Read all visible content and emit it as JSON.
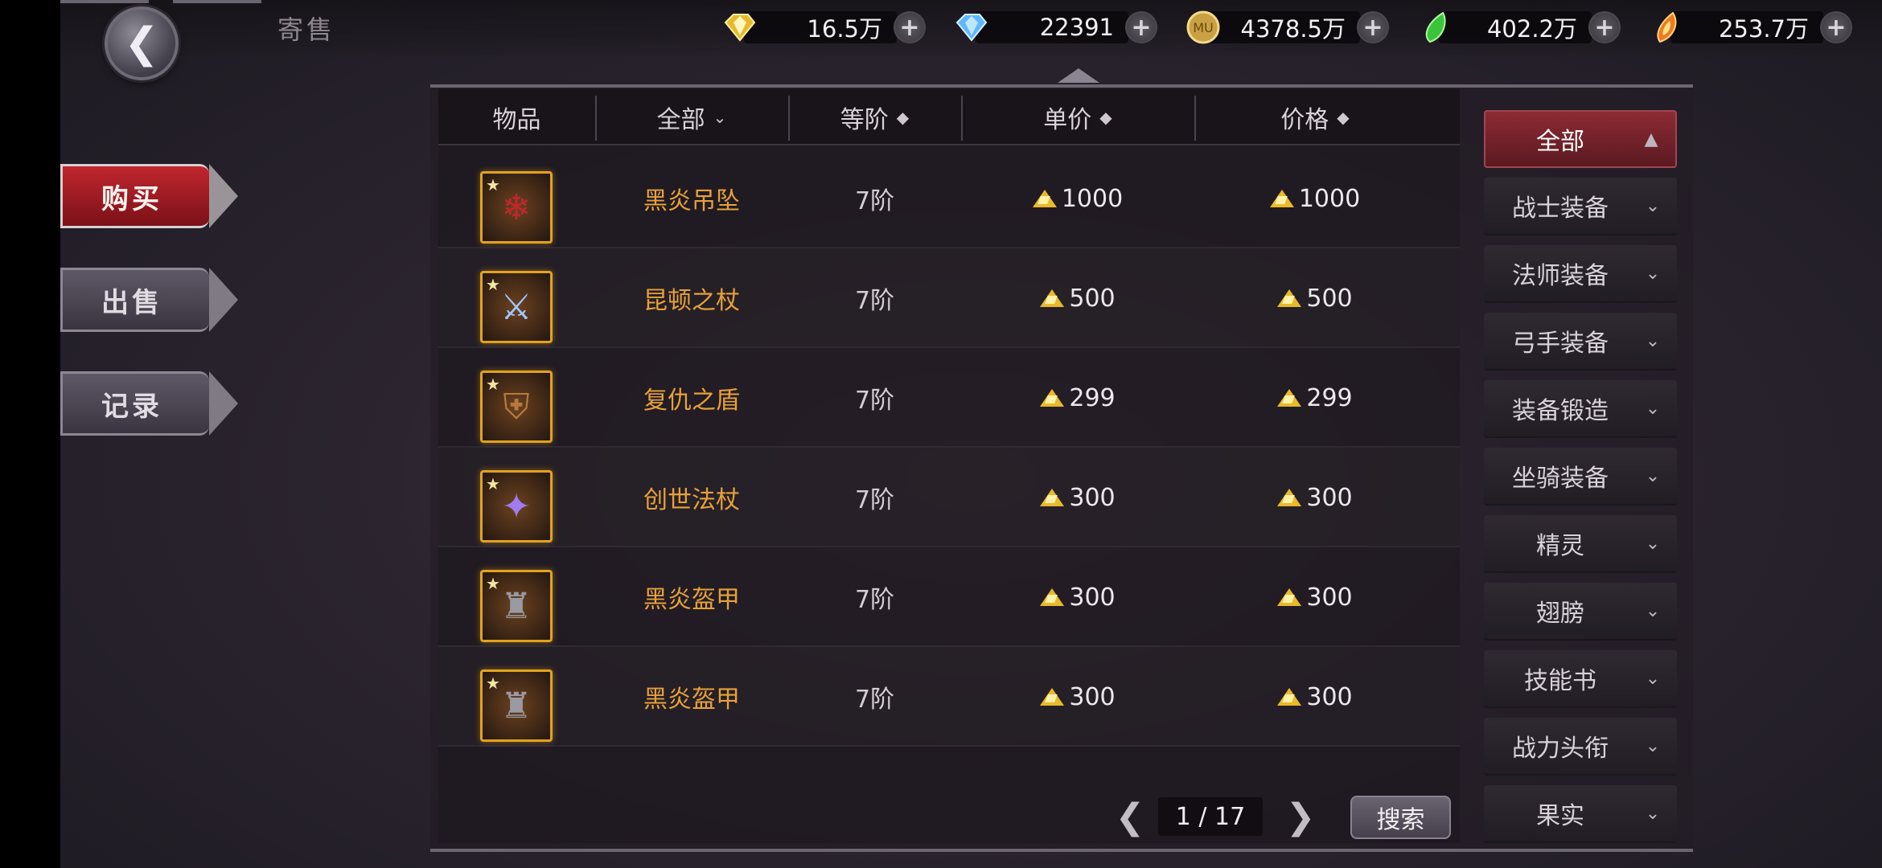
{
  "header": {
    "title": "寄售"
  },
  "currencies": [
    {
      "name": "gold-diamond",
      "value": "16.5万",
      "color": "#e8b92a"
    },
    {
      "name": "blue-diamond",
      "value": "22391",
      "color": "#5fb7ff"
    },
    {
      "name": "mu-coin",
      "value": "4378.5万",
      "color": "#c9a043"
    },
    {
      "name": "green-gem",
      "value": "402.2万",
      "color": "#3bc43b"
    },
    {
      "name": "fire-gem",
      "value": "253.7万",
      "color": "#f07a1c"
    }
  ],
  "tabs": [
    {
      "label": "购买",
      "active": true
    },
    {
      "label": "出售",
      "active": false
    },
    {
      "label": "记录",
      "active": false
    }
  ],
  "table": {
    "headers": {
      "item": "物品",
      "category": "全部",
      "tier": "等阶",
      "unit_price": "单价",
      "price": "价格"
    },
    "rows": [
      {
        "icon": "pendant-icon",
        "name": "黑炎吊坠",
        "tier": "7阶",
        "unit_price": "1000",
        "price": "1000"
      },
      {
        "icon": "staff-icon",
        "name": "昆顿之杖",
        "tier": "7阶",
        "unit_price": "500",
        "price": "500"
      },
      {
        "icon": "shield-icon",
        "name": "复仇之盾",
        "tier": "7阶",
        "unit_price": "299",
        "price": "299"
      },
      {
        "icon": "magic-staff-icon",
        "name": "创世法杖",
        "tier": "7阶",
        "unit_price": "300",
        "price": "300"
      },
      {
        "icon": "armor-icon",
        "name": "黑炎盔甲",
        "tier": "7阶",
        "unit_price": "300",
        "price": "300"
      },
      {
        "icon": "armor-icon",
        "name": "黑炎盔甲",
        "tier": "7阶",
        "unit_price": "300",
        "price": "300"
      }
    ]
  },
  "pagination": {
    "current": "1",
    "separator": "/",
    "total": "17",
    "text": "1 / 17"
  },
  "search_label": "搜索",
  "categories": [
    {
      "label": "全部",
      "active": true
    },
    {
      "label": "战士装备",
      "active": false
    },
    {
      "label": "法师装备",
      "active": false
    },
    {
      "label": "弓手装备",
      "active": false
    },
    {
      "label": "装备锻造",
      "active": false
    },
    {
      "label": "坐骑装备",
      "active": false
    },
    {
      "label": "精灵",
      "active": false
    },
    {
      "label": "翅膀",
      "active": false
    },
    {
      "label": "技能书",
      "active": false
    },
    {
      "label": "战力头衔",
      "active": false
    },
    {
      "label": "果实",
      "active": false
    }
  ],
  "accent_color": "#c0262e",
  "item_name_color": "#e7a13a"
}
